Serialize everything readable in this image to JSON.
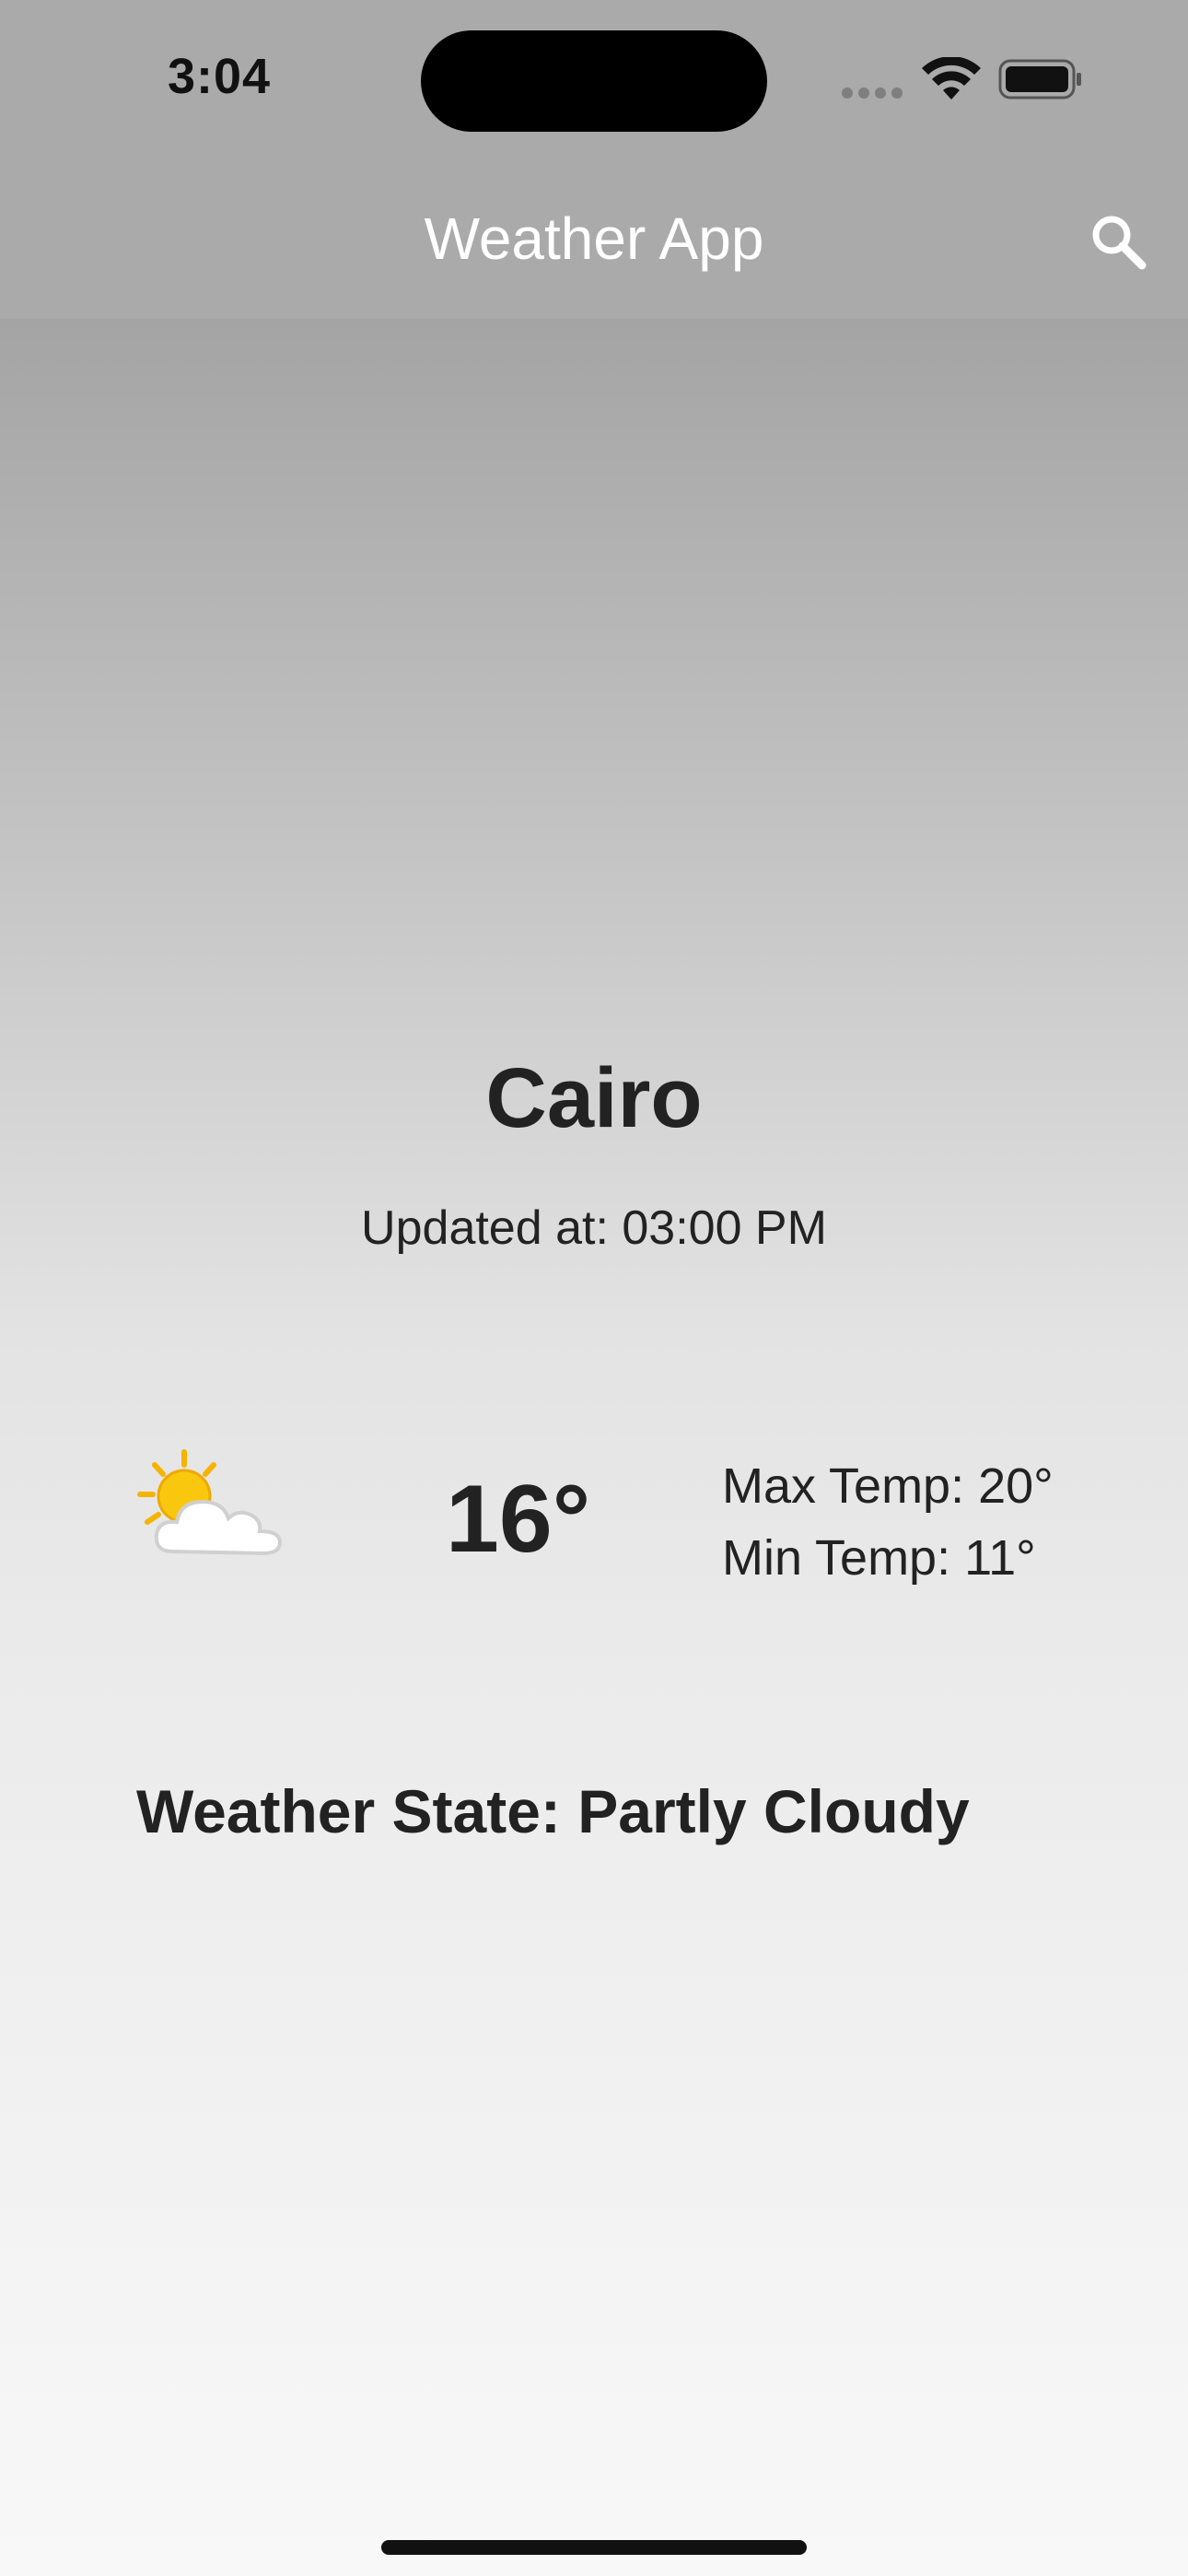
{
  "status_bar": {
    "time": "3:04"
  },
  "app_bar": {
    "title": "Weather App",
    "search_icon": "search-icon"
  },
  "weather": {
    "city": "Cairo",
    "updated_at": "Updated at: 03:00 PM",
    "icon": "partly-cloudy-icon",
    "temperature": "16°",
    "max_temp": "Max Temp: 20°",
    "min_temp": "Min Temp: 11°",
    "state": "Weather State: Partly Cloudy"
  },
  "colors": {
    "app_bar": "#aaaaaa",
    "text_dark": "#222222",
    "sun": "#f9c80e",
    "cloud": "#ffffff"
  }
}
